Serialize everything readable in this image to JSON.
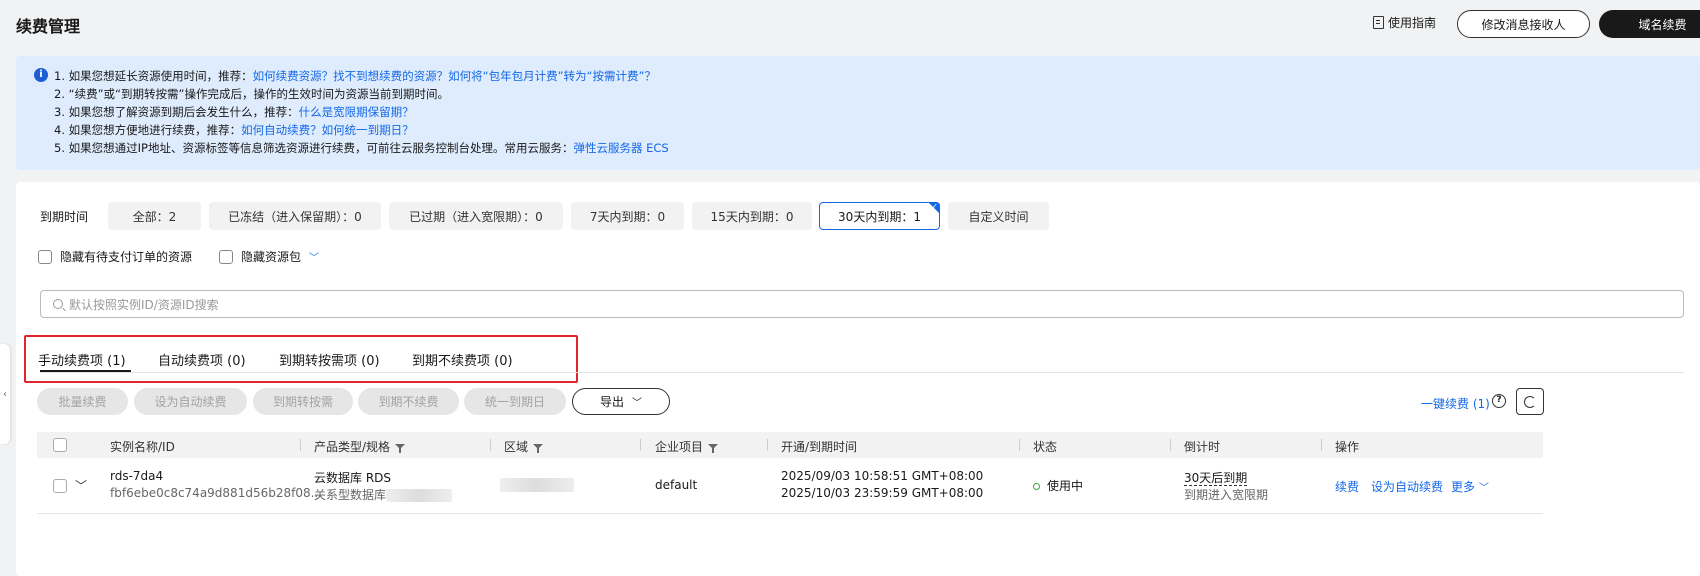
{
  "header": {
    "title": "续费管理",
    "guide_label": "使用指南",
    "modify_receiver_label": "修改消息接收人",
    "domain_renew_label": "域名续费"
  },
  "notice": {
    "line1_prefix": "1. 如果您想延长资源使用时间，推荐：",
    "line1_link": "如何续费资源？找不到想续费的资源？如何将“包年包月计费”转为“按需计费”？",
    "line2": "2. “续费”或“到期转按需”操作完成后，操作的生效时间为资源当前到期时间。",
    "line3_prefix": "3. 如果您想了解资源到期后会发生什么，推荐：",
    "line3_link": "什么是宽限期保留期？",
    "line4_prefix": "4. 如果您想方便地进行续费，推荐：",
    "line4_link": "如何自动续费？如何统一到期日？",
    "line5_prefix": "5. 如果您想通过IP地址、资源标签等信息筛选资源进行续费，可前往云服务控制台处理。常用云服务：",
    "line5_link": "弹性云服务器 ECS"
  },
  "filter": {
    "label": "到期时间",
    "chips": [
      {
        "label": "全部：2"
      },
      {
        "label": "已冻结（进入保留期）：0"
      },
      {
        "label": "已过期（进入宽限期）：0"
      },
      {
        "label": "7天内到期：0"
      },
      {
        "label": "15天内到期：0"
      },
      {
        "label": "30天内到期：1"
      },
      {
        "label": "自定义时间"
      }
    ],
    "hide_pending_label": "隐藏有待支付订单的资源",
    "hide_package_label": "隐藏资源包",
    "search_placeholder": "默认按照实例ID/资源ID搜索"
  },
  "tabs": [
    {
      "label": "手动续费项 (1)"
    },
    {
      "label": "自动续费项 (0)"
    },
    {
      "label": "到期转按需项 (0)"
    },
    {
      "label": "到期不续费项 (0)"
    }
  ],
  "toolbar": {
    "batch_renew": "批量续费",
    "set_auto": "设为自动续费",
    "to_ondemand": "到期转按需",
    "no_renew": "到期不续费",
    "unify_date": "统一到期日",
    "export": "导出",
    "one_key_renew": "一键续费",
    "one_key_count": "(1)"
  },
  "table": {
    "headers": {
      "name": "实例名称/ID",
      "product": "产品类型/规格",
      "region": "区域",
      "project": "企业项目",
      "time": "开通/到期时间",
      "status": "状态",
      "countdown": "倒计时",
      "ops": "操作"
    },
    "row": {
      "name": "rds-7da4",
      "id": "fbf6ebe0c8c74a9d881d56b28f08...",
      "product": "云数据库 RDS",
      "spec_prefix": "关系型数据库",
      "project": "default",
      "open_time": "2025/09/03 10:58:51 GMT+08:00",
      "expire_time": "2025/10/03 23:59:59 GMT+08:00",
      "status": "使用中",
      "countdown": "30天后到期",
      "countdown_sub": "到期进入宽限期",
      "op_renew": "续费",
      "op_auto": "设为自动续费",
      "op_more": "更多"
    }
  },
  "colors": {
    "accent": "#1468e8",
    "notice_bg": "#dfecfd",
    "highlight_border": "#e0262b",
    "status_green": "#3fa53f"
  }
}
